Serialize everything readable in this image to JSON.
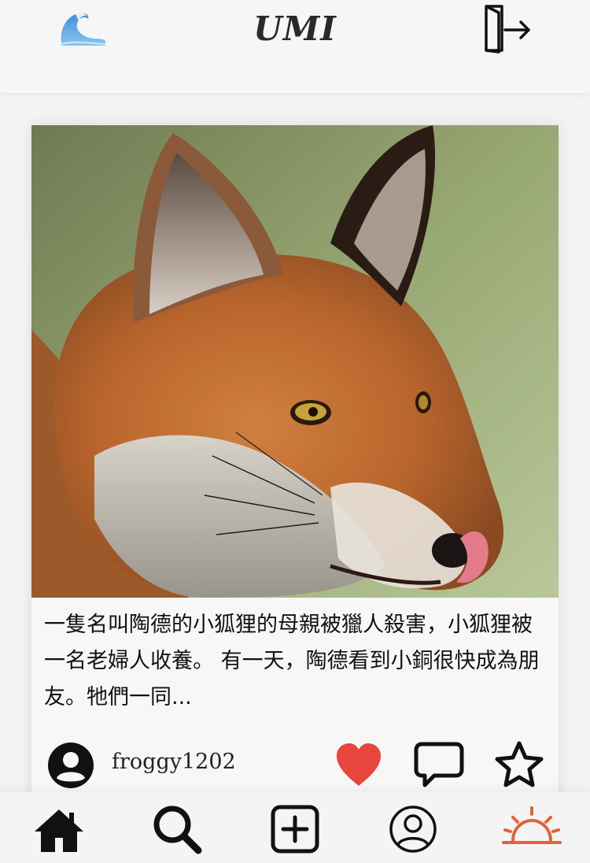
{
  "header": {
    "title": "UMI",
    "logo_icon": "wave-icon",
    "logout_icon": "logout-door-icon"
  },
  "post": {
    "image_alt": "fox",
    "caption": "一隻名叫陶德的小狐狸的母親被獵人殺害，小狐狸被一名老婦人收養。 有一天，陶德看到小銅很快成為朋友。牠們一同...",
    "username": "froggy1202",
    "liked": true,
    "actions": {
      "like_icon": "heart-icon",
      "comment_icon": "comment-bubble-icon",
      "favorite_icon": "star-icon"
    }
  },
  "nav": {
    "items": [
      {
        "name": "home",
        "icon": "home-icon"
      },
      {
        "name": "search",
        "icon": "search-icon"
      },
      {
        "name": "add",
        "icon": "add-square-icon"
      },
      {
        "name": "profile",
        "icon": "profile-icon"
      },
      {
        "name": "sunrise",
        "icon": "sunrise-icon",
        "active": true
      }
    ]
  },
  "colors": {
    "like": "#e8453c",
    "active_nav": "#e0643a",
    "title": "#2a2a2a",
    "wave": "#5aa8e0"
  }
}
